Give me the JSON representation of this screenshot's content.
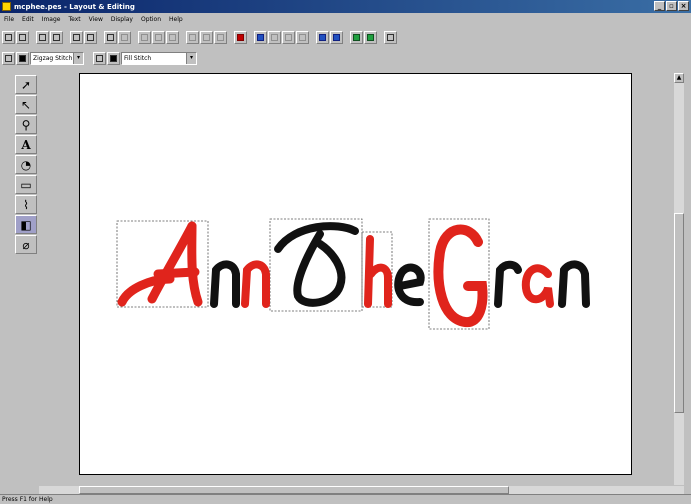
{
  "window": {
    "title": "mcphee.pes - Layout & Editing"
  },
  "menu": [
    "File",
    "Edit",
    "Image",
    "Text",
    "View",
    "Display",
    "Option",
    "Help"
  ],
  "toolbar2": {
    "line_stitch": "Zigzag Stitch",
    "region_stitch": "Fill Stitch"
  },
  "tools": [
    "select-icon",
    "point-edit-icon",
    "zoom-icon",
    "text-icon",
    "circle-arc-icon",
    "rectangle-icon",
    "stamp-icon",
    "shape-icon",
    "eraser-icon"
  ],
  "design": {
    "text": "AnnTheGran",
    "colors": {
      "red": "#e0241c",
      "black": "#111111"
    }
  },
  "status": {
    "text": "Press F1 for Help"
  }
}
